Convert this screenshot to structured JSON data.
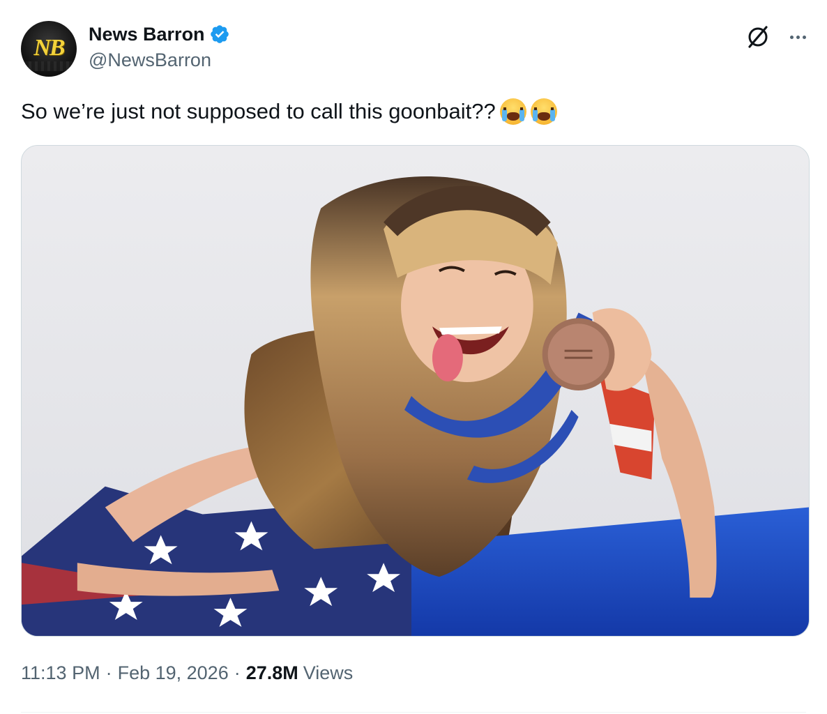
{
  "author": {
    "display_name": "News Barron",
    "handle": "@NewsBarron",
    "avatar_text": "NB",
    "verified": true
  },
  "tweet": {
    "text": "So we’re just not supposed to call this goonbait??",
    "emojis": [
      "loudly-crying-face",
      "loudly-crying-face"
    ]
  },
  "meta": {
    "time": "11:13 PM",
    "separator": "·",
    "date": "Feb 19, 2026",
    "views_count": "27.8M",
    "views_label": "Views"
  },
  "icons": {
    "verified": "verified-badge-icon",
    "grok": "grok-icon",
    "more": "more-icon"
  },
  "colors": {
    "primary_text": "#0f1419",
    "secondary_text": "#536471",
    "verified_blue": "#1d9bf0",
    "border": "#cfd9de"
  }
}
